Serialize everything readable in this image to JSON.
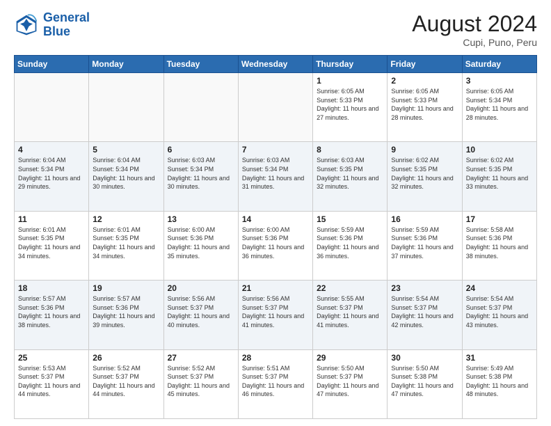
{
  "header": {
    "logo_line1": "General",
    "logo_line2": "Blue",
    "month_year": "August 2024",
    "location": "Cupi, Puno, Peru"
  },
  "weekdays": [
    "Sunday",
    "Monday",
    "Tuesday",
    "Wednesday",
    "Thursday",
    "Friday",
    "Saturday"
  ],
  "weeks": [
    [
      {
        "num": "",
        "info": ""
      },
      {
        "num": "",
        "info": ""
      },
      {
        "num": "",
        "info": ""
      },
      {
        "num": "",
        "info": ""
      },
      {
        "num": "1",
        "info": "Sunrise: 6:05 AM\nSunset: 5:33 PM\nDaylight: 11 hours\nand 27 minutes."
      },
      {
        "num": "2",
        "info": "Sunrise: 6:05 AM\nSunset: 5:33 PM\nDaylight: 11 hours\nand 28 minutes."
      },
      {
        "num": "3",
        "info": "Sunrise: 6:05 AM\nSunset: 5:34 PM\nDaylight: 11 hours\nand 28 minutes."
      }
    ],
    [
      {
        "num": "4",
        "info": "Sunrise: 6:04 AM\nSunset: 5:34 PM\nDaylight: 11 hours\nand 29 minutes."
      },
      {
        "num": "5",
        "info": "Sunrise: 6:04 AM\nSunset: 5:34 PM\nDaylight: 11 hours\nand 30 minutes."
      },
      {
        "num": "6",
        "info": "Sunrise: 6:03 AM\nSunset: 5:34 PM\nDaylight: 11 hours\nand 30 minutes."
      },
      {
        "num": "7",
        "info": "Sunrise: 6:03 AM\nSunset: 5:34 PM\nDaylight: 11 hours\nand 31 minutes."
      },
      {
        "num": "8",
        "info": "Sunrise: 6:03 AM\nSunset: 5:35 PM\nDaylight: 11 hours\nand 32 minutes."
      },
      {
        "num": "9",
        "info": "Sunrise: 6:02 AM\nSunset: 5:35 PM\nDaylight: 11 hours\nand 32 minutes."
      },
      {
        "num": "10",
        "info": "Sunrise: 6:02 AM\nSunset: 5:35 PM\nDaylight: 11 hours\nand 33 minutes."
      }
    ],
    [
      {
        "num": "11",
        "info": "Sunrise: 6:01 AM\nSunset: 5:35 PM\nDaylight: 11 hours\nand 34 minutes."
      },
      {
        "num": "12",
        "info": "Sunrise: 6:01 AM\nSunset: 5:35 PM\nDaylight: 11 hours\nand 34 minutes."
      },
      {
        "num": "13",
        "info": "Sunrise: 6:00 AM\nSunset: 5:36 PM\nDaylight: 11 hours\nand 35 minutes."
      },
      {
        "num": "14",
        "info": "Sunrise: 6:00 AM\nSunset: 5:36 PM\nDaylight: 11 hours\nand 36 minutes."
      },
      {
        "num": "15",
        "info": "Sunrise: 5:59 AM\nSunset: 5:36 PM\nDaylight: 11 hours\nand 36 minutes."
      },
      {
        "num": "16",
        "info": "Sunrise: 5:59 AM\nSunset: 5:36 PM\nDaylight: 11 hours\nand 37 minutes."
      },
      {
        "num": "17",
        "info": "Sunrise: 5:58 AM\nSunset: 5:36 PM\nDaylight: 11 hours\nand 38 minutes."
      }
    ],
    [
      {
        "num": "18",
        "info": "Sunrise: 5:57 AM\nSunset: 5:36 PM\nDaylight: 11 hours\nand 38 minutes."
      },
      {
        "num": "19",
        "info": "Sunrise: 5:57 AM\nSunset: 5:36 PM\nDaylight: 11 hours\nand 39 minutes."
      },
      {
        "num": "20",
        "info": "Sunrise: 5:56 AM\nSunset: 5:37 PM\nDaylight: 11 hours\nand 40 minutes."
      },
      {
        "num": "21",
        "info": "Sunrise: 5:56 AM\nSunset: 5:37 PM\nDaylight: 11 hours\nand 41 minutes."
      },
      {
        "num": "22",
        "info": "Sunrise: 5:55 AM\nSunset: 5:37 PM\nDaylight: 11 hours\nand 41 minutes."
      },
      {
        "num": "23",
        "info": "Sunrise: 5:54 AM\nSunset: 5:37 PM\nDaylight: 11 hours\nand 42 minutes."
      },
      {
        "num": "24",
        "info": "Sunrise: 5:54 AM\nSunset: 5:37 PM\nDaylight: 11 hours\nand 43 minutes."
      }
    ],
    [
      {
        "num": "25",
        "info": "Sunrise: 5:53 AM\nSunset: 5:37 PM\nDaylight: 11 hours\nand 44 minutes."
      },
      {
        "num": "26",
        "info": "Sunrise: 5:52 AM\nSunset: 5:37 PM\nDaylight: 11 hours\nand 44 minutes."
      },
      {
        "num": "27",
        "info": "Sunrise: 5:52 AM\nSunset: 5:37 PM\nDaylight: 11 hours\nand 45 minutes."
      },
      {
        "num": "28",
        "info": "Sunrise: 5:51 AM\nSunset: 5:37 PM\nDaylight: 11 hours\nand 46 minutes."
      },
      {
        "num": "29",
        "info": "Sunrise: 5:50 AM\nSunset: 5:37 PM\nDaylight: 11 hours\nand 47 minutes."
      },
      {
        "num": "30",
        "info": "Sunrise: 5:50 AM\nSunset: 5:38 PM\nDaylight: 11 hours\nand 47 minutes."
      },
      {
        "num": "31",
        "info": "Sunrise: 5:49 AM\nSunset: 5:38 PM\nDaylight: 11 hours\nand 48 minutes."
      }
    ]
  ]
}
